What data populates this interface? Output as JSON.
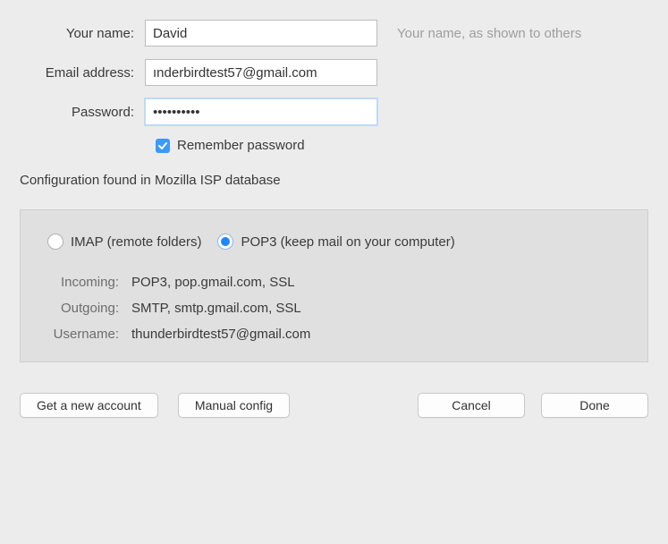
{
  "form": {
    "name_label": "Your name:",
    "name_value": "David",
    "name_hint": "Your name, as shown to others",
    "email_label": "Email address:",
    "email_value": "ınderbirdtest57@gmail.com",
    "password_label": "Password:",
    "password_value": "••••••••••",
    "remember_checked": true,
    "remember_label": "Remember password"
  },
  "status_text": "Configuration found in Mozilla ISP database",
  "protocol": {
    "imap_label": "IMAP (remote folders)",
    "pop3_label": "POP3 (keep mail on your computer)",
    "selected": "pop3"
  },
  "details": {
    "incoming_label": "Incoming:",
    "incoming_value": "POP3, pop.gmail.com, SSL",
    "outgoing_label": "Outgoing:",
    "outgoing_value": "SMTP, smtp.gmail.com, SSL",
    "username_label": "Username:",
    "username_value": "thunderbirdtest57@gmail.com"
  },
  "buttons": {
    "new_account": "Get a new account",
    "manual_config": "Manual config",
    "cancel": "Cancel",
    "done": "Done"
  }
}
